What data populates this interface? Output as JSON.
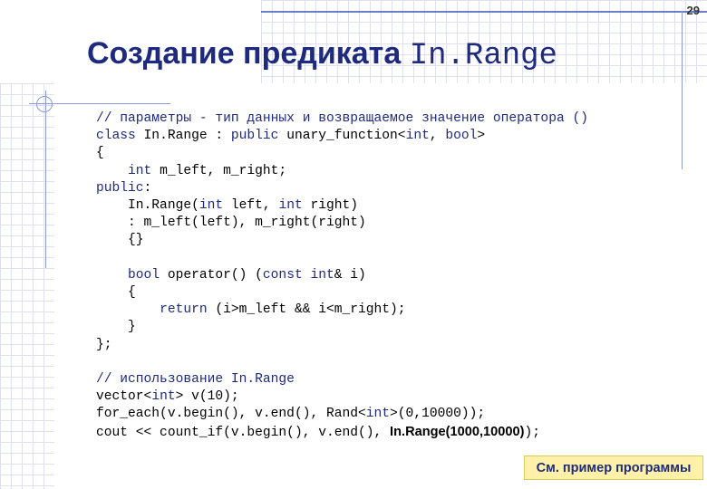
{
  "page_number": "29",
  "title": {
    "text": "Создание предиката ",
    "mono": "In.Range"
  },
  "code": {
    "l1": "// параметры - тип данных и возвращаемое значение оператора ()",
    "l2_kw1": "class",
    "l2_a": " In.Range : ",
    "l2_kw2": "public",
    "l2_b": " unary_function<",
    "l2_kw3": "int",
    "l2_c": ", ",
    "l2_kw4": "bool",
    "l2_d": ">",
    "l3": "{",
    "l4_indent": "    ",
    "l4_kw": "int",
    "l4_rest": " m_left, m_right;",
    "l5_kw": "public",
    "l5_rest": ":",
    "l6_a": "    In.Range(",
    "l6_kw1": "int",
    "l6_b": " left, ",
    "l6_kw2": "int",
    "l6_c": " right)",
    "l7": "    : m_left(left), m_right(right)",
    "l8": "    {}",
    "l10_indent": "    ",
    "l10_kw1": "bool",
    "l10_a": " operator() (",
    "l10_kw2": "const",
    "l10_b": " ",
    "l10_kw3": "int",
    "l10_c": "& i)",
    "l11": "    {",
    "l12_indent": "        ",
    "l12_kw": "return",
    "l12_rest": " (i>m_left && i<m_right);",
    "l13": "    }",
    "l14": "};",
    "l16": "// использование In.Range",
    "l17_a": "vector<",
    "l17_kw": "int",
    "l17_b": "> v(10);",
    "l18_a": "for_each(v.begin(), v.end(), Rand<",
    "l18_kw": "int",
    "l18_b": ">(0,10000));",
    "l19_a": "cout << count_if(v.begin(), v.end(), ",
    "l19_bold": "In.Range(1000,10000)",
    "l19_b": ");"
  },
  "button_label": "См. пример программы",
  "colors": {
    "accent": "#1e2a7d",
    "button_bg": "#fff2a8",
    "rule": "#6b7fc7"
  }
}
